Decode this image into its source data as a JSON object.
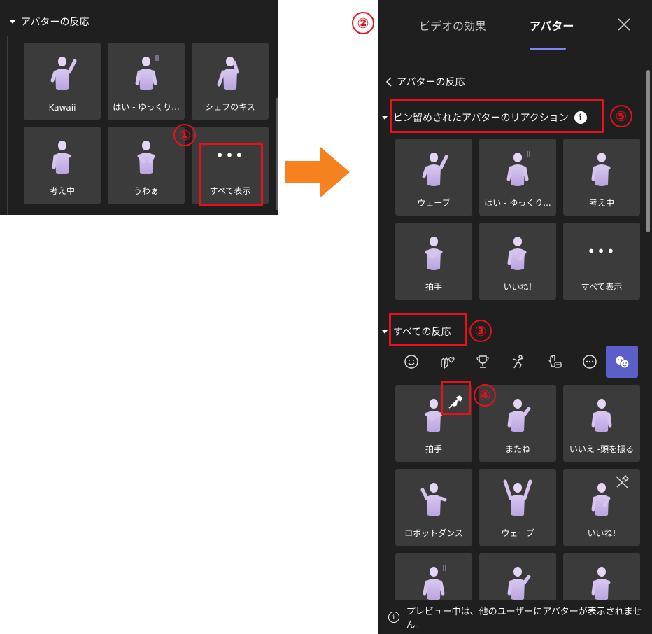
{
  "left_panel": {
    "section_title": "アバターの反応",
    "tiles": [
      {
        "label": "Kawaii",
        "fig": "wave"
      },
      {
        "label": "はい - ゆっくり...",
        "fig": "nod"
      },
      {
        "label": "シェフのキス",
        "fig": "kiss"
      },
      {
        "label": "考え中",
        "fig": "think"
      },
      {
        "label": "うわぁ",
        "fig": "wow"
      },
      {
        "label": "すべて表示",
        "fig": "more"
      }
    ],
    "more_dots": "•••"
  },
  "right_panel": {
    "tabs": {
      "effects": "ビデオの効果",
      "avatar": "アバター"
    },
    "back_label": "アバターの反応",
    "pinned_title": "ピン留めされたアバターのリアクション",
    "info_glyph": "i",
    "pinned_tiles": [
      {
        "label": "ウェーブ",
        "fig": "wave"
      },
      {
        "label": "はい - ゆっくり...",
        "fig": "nod"
      },
      {
        "label": "考え中",
        "fig": "think"
      },
      {
        "label": "拍手",
        "fig": "clap"
      },
      {
        "label": "いいね!",
        "fig": "like"
      },
      {
        "label": "すべて表示",
        "fig": "more"
      }
    ],
    "more_dots": "•••",
    "all_title": "すべての反応",
    "categories": [
      "smile-icon",
      "hands-heart-icon",
      "trophy-icon",
      "dance-icon",
      "hand-chat-icon",
      "more-circle-icon",
      "emoji-active-icon"
    ],
    "all_tiles": [
      {
        "label": "拍手",
        "fig": "clap"
      },
      {
        "label": "またね",
        "fig": "bye"
      },
      {
        "label": "いいえ -頭を振る",
        "fig": "no"
      },
      {
        "label": "ロボットダンス",
        "fig": "robot"
      },
      {
        "label": "ウェーブ",
        "fig": "cheer"
      },
      {
        "label": "いいね!",
        "fig": "like"
      },
      {
        "label": "",
        "fig": "nod"
      },
      {
        "label": "",
        "fig": "bye"
      },
      {
        "label": "",
        "fig": "think"
      }
    ],
    "footer_glyph": "i",
    "footer_text": "プレビュー中は、他のユーザーにアバターが表示されません。"
  },
  "annotations": [
    "①",
    "②",
    "③",
    "④",
    "⑤"
  ],
  "colors": {
    "panel_bg": "#1f1f1f",
    "tile_bg": "#3b3b3b",
    "accent": "#5b5fc7",
    "annotation": "#e8101a",
    "arrow": "#f5821f"
  }
}
